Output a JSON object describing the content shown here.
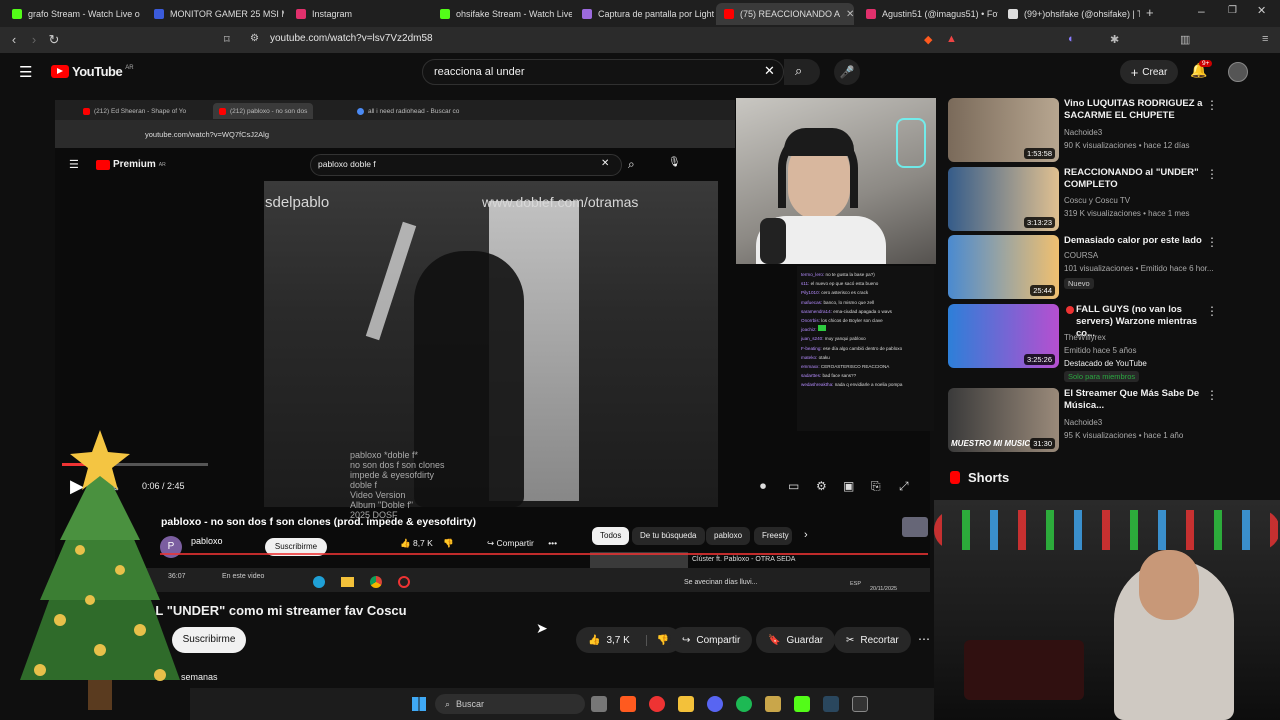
{
  "browser": {
    "tabs": [
      {
        "label": "grafo Stream - Watch Live o",
        "color": "#53fc18"
      },
      {
        "label": "MONITOR GAMER 25 MSI MA",
        "color": "#3b5bdb"
      },
      {
        "label": "Instagram",
        "color": "#e1306c"
      },
      {
        "label": "ohsifake Stream - Watch Live o",
        "color": "#53fc18"
      },
      {
        "label": "Captura de pantalla por Lights",
        "color": "#9c6ade"
      },
      {
        "label": "(75) REACCIONANDO A",
        "color": "#ff0000"
      },
      {
        "label": "Agustin51 (@imagus51) • Foto",
        "color": "#e1306c"
      },
      {
        "label": "(99+)ohsifake (@ohsifake) | Tik",
        "color": "#dddddd"
      }
    ],
    "url": "youtube.com/watch?v=lsv7Vz2dm58"
  },
  "youtube": {
    "logo_text": "YouTube",
    "logo_region": "AR",
    "search_value": "reacciona al under",
    "create_label": "Crear",
    "notifications": "9+"
  },
  "embedded": {
    "tabs": [
      "(212) Ed Sheeran - Shape of Yo",
      "(212) pabloxo - no son dos",
      "all i need radiohead - Buscar co"
    ],
    "url": "youtube.com/watch?v=WQ7fCsJ2Alg",
    "logo_text": "Premium",
    "logo_region": "AR",
    "search_value": "pabloxo doble f",
    "video_overlay_left": "sdelpablo",
    "video_overlay_right": "www.doblef.com/otramas",
    "video_caption": "pabloxo *doble f*\nno son dos f son clones\nimpede & eyesofdirty\ndoble f\nVideo Version\nAlbum \"Doble f\"\n2025 DOSF",
    "time": "0:06 / 2:45",
    "progress": 0.28,
    "title": "pabloxo - no son dos f son clones (prod. impede & eyesofdirty)",
    "channel": "pabloxo",
    "channel_initial": "P",
    "subscribe": "Suscribirme",
    "likes": "8,7 K",
    "share": "Compartir",
    "chips": [
      "Todos",
      "De tu búsqueda",
      "pabloxo",
      "Freesty"
    ],
    "up_next": "Clúster ft. Pabloxo - OTRA SEDA",
    "taskbar_time": "36:07",
    "taskbar_label": "En este video",
    "news": "Se avecinan días lluvi...",
    "date": "20/11/2025",
    "lang": "ESP"
  },
  "chat": [
    {
      "user": "termo_lero:",
      "msg": "no te gusta la base pa?)"
    },
    {
      "user": "s11:",
      "msg": "el nuevo ep que sacó esta bueno"
    },
    {
      "user": "Pily1010:",
      "msg": "cero asterisco es crack"
    },
    {
      "user": "mafuecas:",
      "msg": "banco, lo mismo que zell"
    },
    {
      "user": "saramendra14:",
      "msg": "ema-ciudad apagada o wavs"
    },
    {
      "user": "Onorrbis:",
      "msg": "los chicos de Boyler son clave"
    },
    {
      "user": "joachiz:",
      "msg": ""
    },
    {
      "user": "juan_s240:",
      "msg": "muy yanqui pabloxo"
    },
    {
      "user": "F-beating:",
      "msg": "ese día algo cambió dentro de pabloxo"
    },
    {
      "user": "mateko:",
      "msg": "otaku"
    },
    {
      "user": "emmaxx:",
      "msg": "CEROASTERISCO REACCIONA"
    },
    {
      "user": "sadarttes:",
      "msg": "bad face sans??"
    },
    {
      "user": "wedashreaktha:",
      "msg": "nada q envidiarle a noelia pompa"
    }
  ],
  "main": {
    "title": "AL \"UNDER\" como mi streamer fav Coscu",
    "subscribe": "Suscribirme",
    "likes": "3,7 K",
    "share": "Compartir",
    "save": "Guardar",
    "clip": "Recortar",
    "date_fragment": "semanas"
  },
  "recommendations": [
    {
      "title": "Vino LUQUITAS RODRIGUEZ a SACARME EL CHUPETE",
      "channel": "Nachoide3",
      "meta": "90 K visualizaciones • hace 12 días",
      "duration": "1:53:58",
      "badge": "",
      "colors": [
        "#7a6a5a",
        "#b7a690"
      ]
    },
    {
      "title": "REACCIONANDO al \"UNDER\" COMPLETO",
      "channel": "Coscu  y Coscu TV",
      "meta": "319 K visualizaciones • hace 1 mes",
      "duration": "3:13:23",
      "badge": "",
      "colors": [
        "#355c8a",
        "#e0c090"
      ]
    },
    {
      "title": "Demasiado calor por este lado",
      "channel": "COURSA",
      "meta": "101 visualizaciones • Emitido hace 6 hor...",
      "duration": "25:44",
      "badge": "Nuevo",
      "colors": [
        "#4a8ad0",
        "#f0c070"
      ]
    },
    {
      "title": "FALL GUYS (no van los servers) Warzone mientras co...",
      "channel": "TheWillyrex",
      "meta": "Emitido hace 5 años",
      "duration": "3:25:26",
      "badge": "Destacado de YouTube",
      "badge2": "Solo para miembros",
      "colors": [
        "#2d7fd8",
        "#b64fd0"
      ]
    },
    {
      "title": "El Streamer Que Más Sabe De Música...",
      "channel": "Nachoide3",
      "meta": "95 K visualizaciones • hace 1 año",
      "duration": "31:30",
      "badge": "",
      "thumb_text": "MUESTRO MI MUSIC",
      "colors": [
        "#3a3a3a",
        "#9a8a7a"
      ]
    }
  ],
  "shorts_label": "Shorts",
  "windows": {
    "search_placeholder": "Buscar"
  }
}
